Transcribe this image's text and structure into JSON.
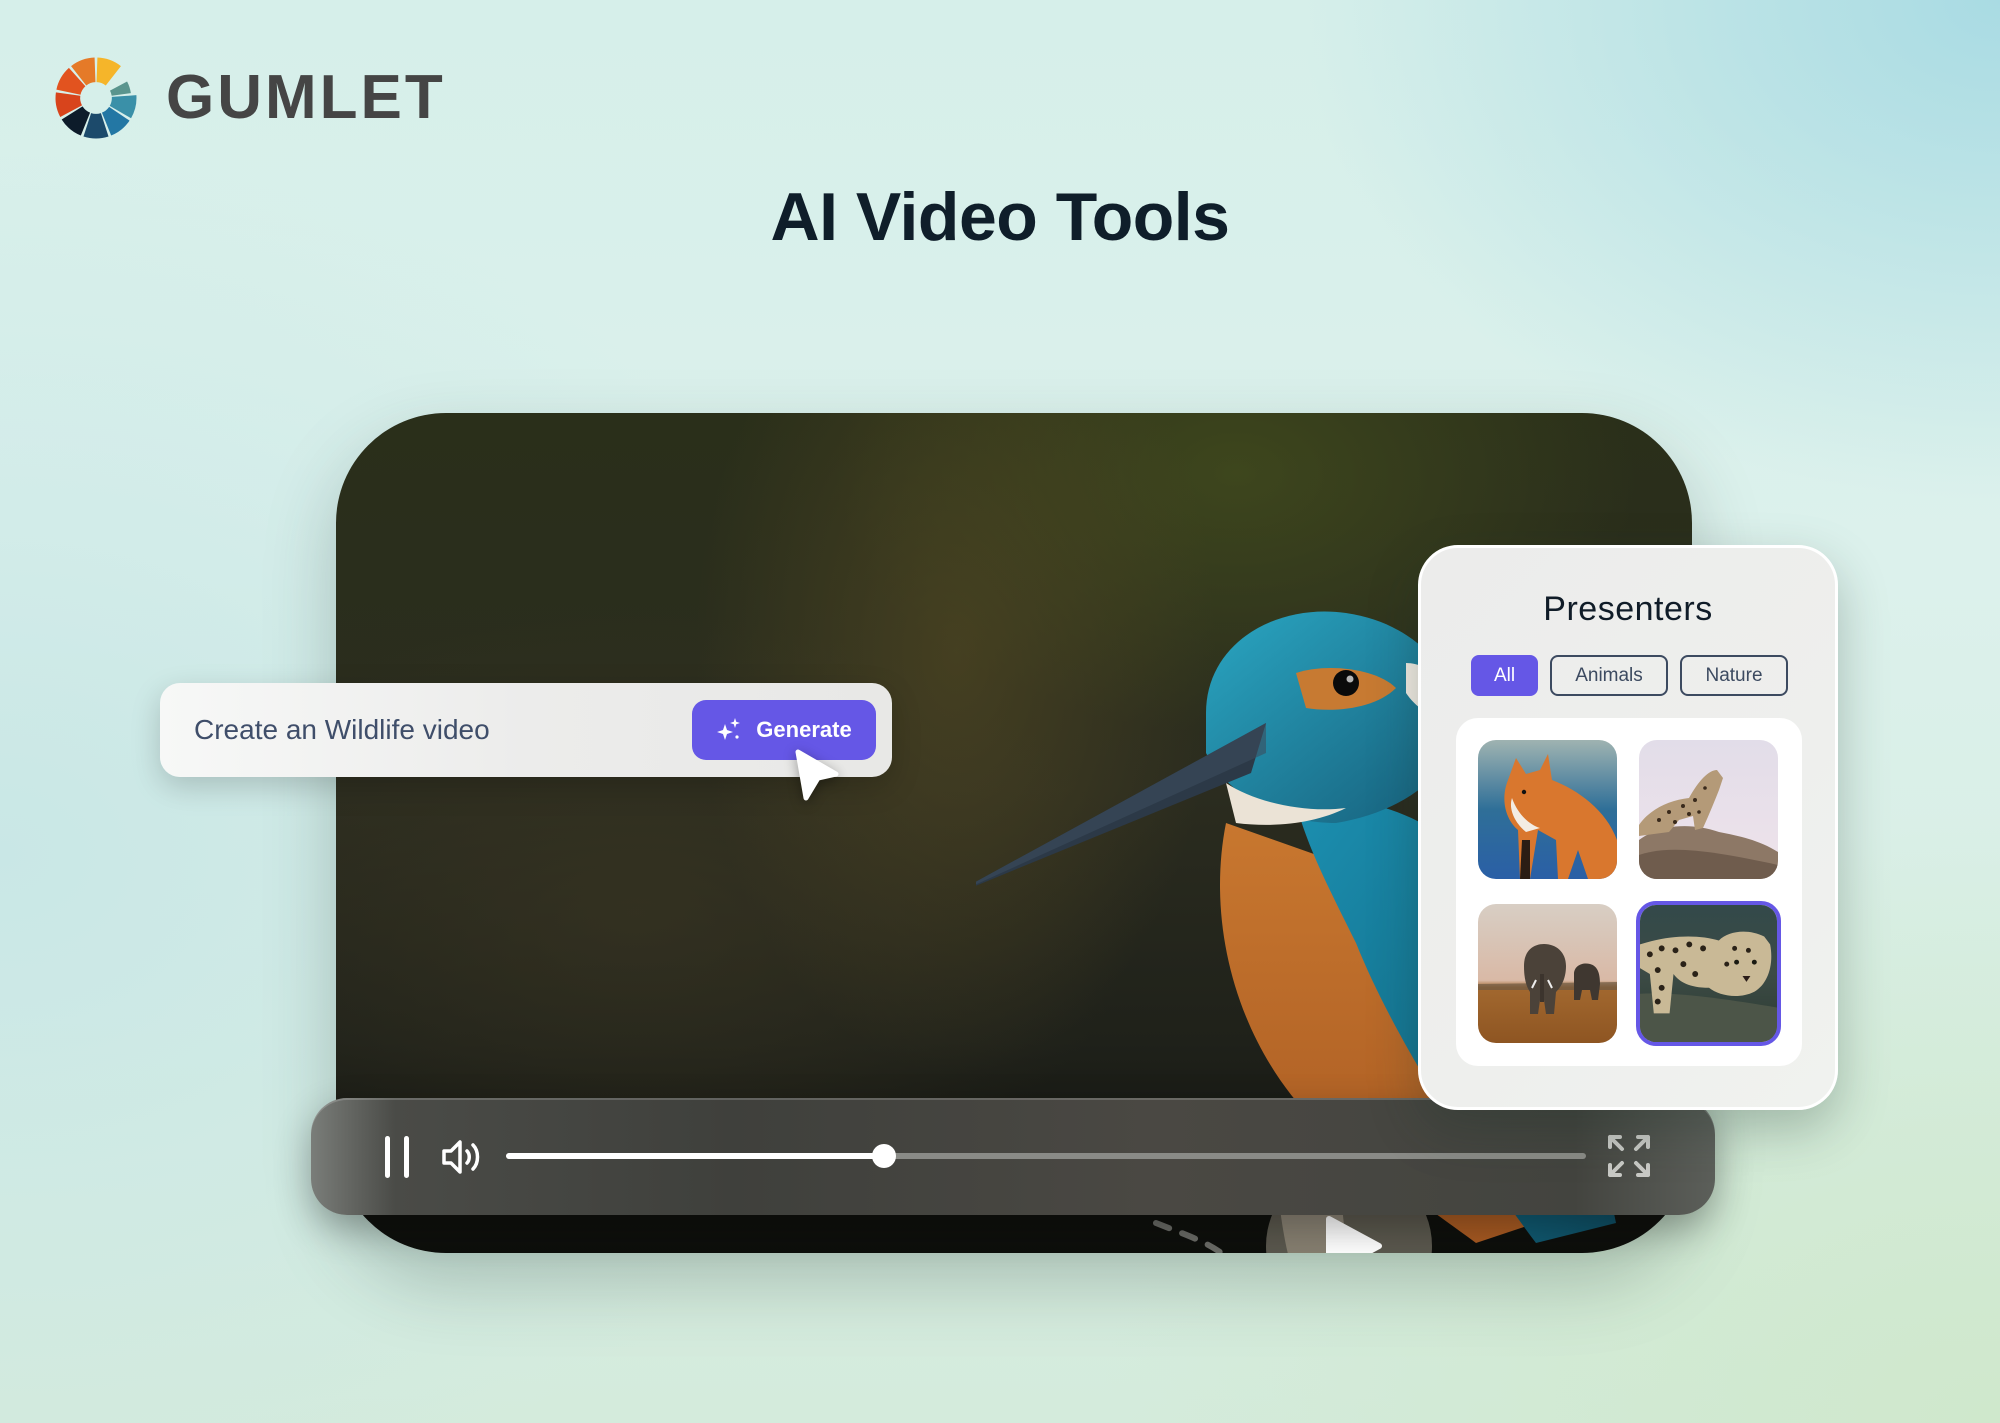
{
  "brand": {
    "name": "GUMLET",
    "logo_icon": "gumlet-logo-icon",
    "logo_colors": [
      "#f5b52a",
      "#e57a28",
      "#e2531f",
      "#d8441c",
      "#0d1b2a",
      "#1c4a6b",
      "#2377a4",
      "#3a90a8",
      "#5a958e"
    ]
  },
  "page": {
    "title": "AI Video Tools"
  },
  "prompt": {
    "value": "Create an Wildlife video",
    "placeholder": "Create an Wildlife video",
    "generate_label": "Generate",
    "generate_icon": "sparkles-icon",
    "accent_color": "#6557e6"
  },
  "player": {
    "subject": "kingfisher",
    "play_icon": "play-icon",
    "pause_icon": "pause-icon",
    "volume_icon": "volume-icon",
    "fullscreen_icon": "fullscreen-icon",
    "progress_percent": 35
  },
  "presenters": {
    "title": "Presenters",
    "filters": [
      {
        "label": "All",
        "active": true
      },
      {
        "label": "Animals",
        "active": false
      },
      {
        "label": "Nature",
        "active": false
      }
    ],
    "items": [
      {
        "subject": "red fox",
        "selected": false
      },
      {
        "subject": "leopard on rock",
        "selected": false
      },
      {
        "subject": "elephants in savanna",
        "selected": false
      },
      {
        "subject": "resting leopard",
        "selected": true
      }
    ]
  }
}
